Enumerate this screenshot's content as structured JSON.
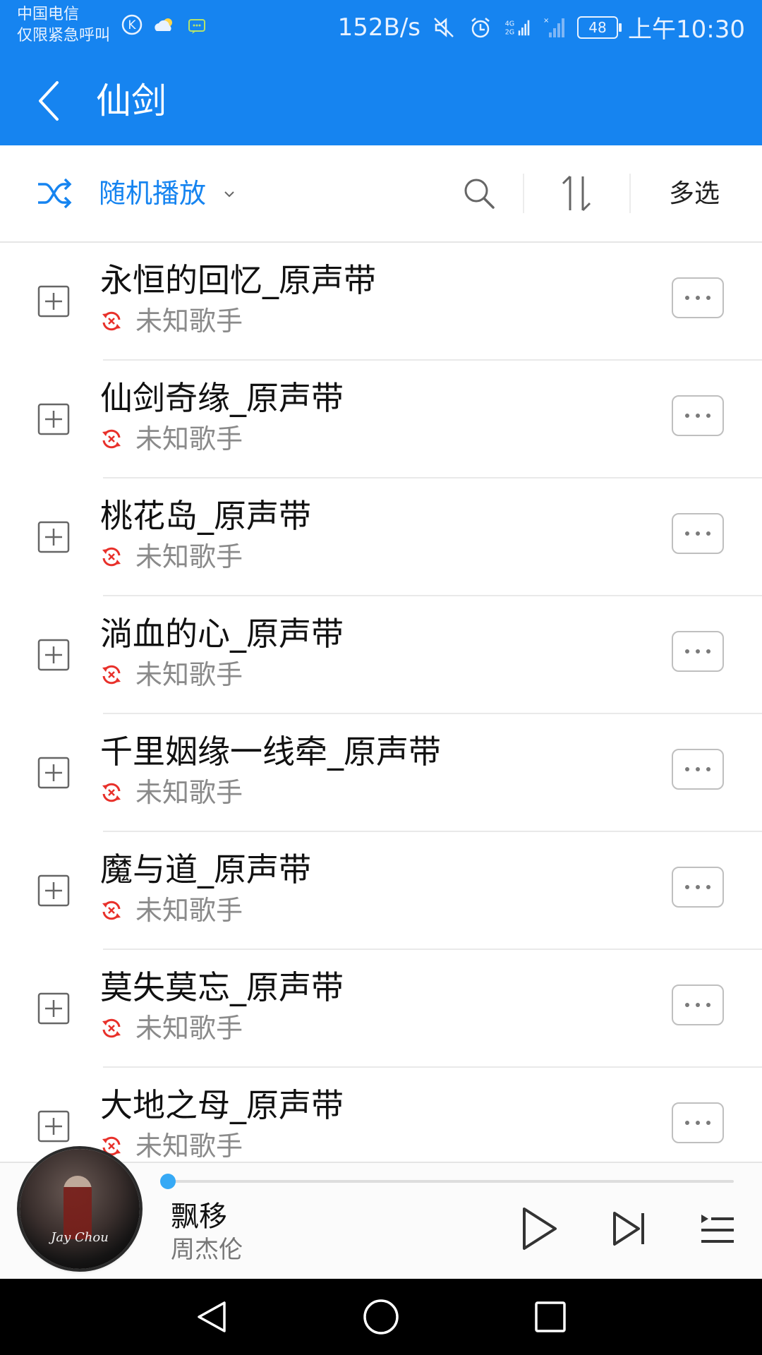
{
  "status_bar": {
    "carrier_line1": "中国电信",
    "carrier_line2": "仅限紧急呼叫",
    "net_speed": "152B/s",
    "battery": "48",
    "time": "上午10:30",
    "icons": [
      "k-app-icon",
      "weather-icon",
      "message-icon",
      "mute-icon",
      "alarm-icon",
      "signal-4g-icon",
      "signal-icon"
    ]
  },
  "header": {
    "title": "仙剑",
    "accent_color": "#1684f0"
  },
  "toolbar": {
    "shuffle_label": "随机播放",
    "multi_select_label": "多选"
  },
  "songs": [
    {
      "title": "永恒的回忆_原声带",
      "artist": "未知歌手"
    },
    {
      "title": "仙剑奇缘_原声带",
      "artist": "未知歌手"
    },
    {
      "title": "桃花岛_原声带",
      "artist": "未知歌手"
    },
    {
      "title": "淌血的心_原声带",
      "artist": "未知歌手"
    },
    {
      "title": "千里姻缘一线牵_原声带",
      "artist": "未知歌手"
    },
    {
      "title": "魔与道_原声带",
      "artist": "未知歌手"
    },
    {
      "title": "莫失莫忘_原声带",
      "artist": "未知歌手"
    },
    {
      "title": "大地之母_原声带",
      "artist": "未知歌手"
    }
  ],
  "player": {
    "title": "飘移",
    "artist": "周杰伦",
    "cover_text": "Jay Chou",
    "progress_percent": 0
  }
}
